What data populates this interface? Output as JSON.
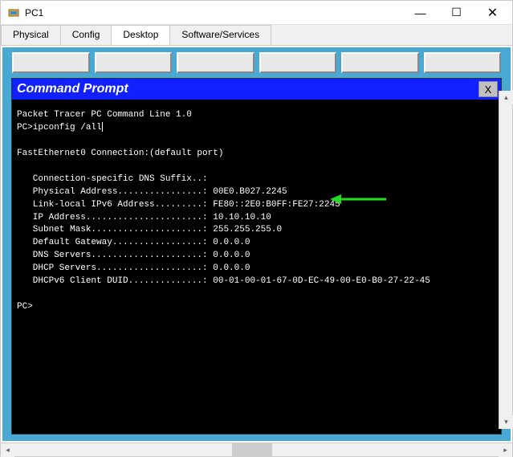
{
  "window": {
    "title": "PC1",
    "controls": {
      "minimize": "—",
      "maximize": "☐",
      "close": "✕"
    }
  },
  "tabs": {
    "items": [
      "Physical",
      "Config",
      "Desktop",
      "Software/Services"
    ],
    "active": 2
  },
  "cmd": {
    "title": "Command Prompt",
    "close_label": "X",
    "banner": "Packet Tracer PC Command Line 1.0",
    "prompt1": "PC>",
    "command": "ipconfig /all",
    "interface_line": "FastEthernet0 Connection:(default port)",
    "lines": [
      {
        "label": "Connection-specific DNS Suffix..:",
        "value": ""
      },
      {
        "label": "Physical Address................:",
        "value": "00E0.B027.2245"
      },
      {
        "label": "Link-local IPv6 Address.........:",
        "value": "FE80::2E0:B0FF:FE27:2245"
      },
      {
        "label": "IP Address......................:",
        "value": "10.10.10.10"
      },
      {
        "label": "Subnet Mask.....................:",
        "value": "255.255.255.0"
      },
      {
        "label": "Default Gateway.................:",
        "value": "0.0.0.0"
      },
      {
        "label": "DNS Servers.....................:",
        "value": "0.0.0.0"
      },
      {
        "label": "DHCP Servers....................:",
        "value": "0.0.0.0"
      },
      {
        "label": "DHCPv6 Client DUID..............:",
        "value": "00-01-00-01-67-0D-EC-49-00-E0-B0-27-22-45"
      }
    ],
    "prompt2": "PC>",
    "indent": "   "
  },
  "annotation": {
    "arrow_color": "#22dd22"
  }
}
